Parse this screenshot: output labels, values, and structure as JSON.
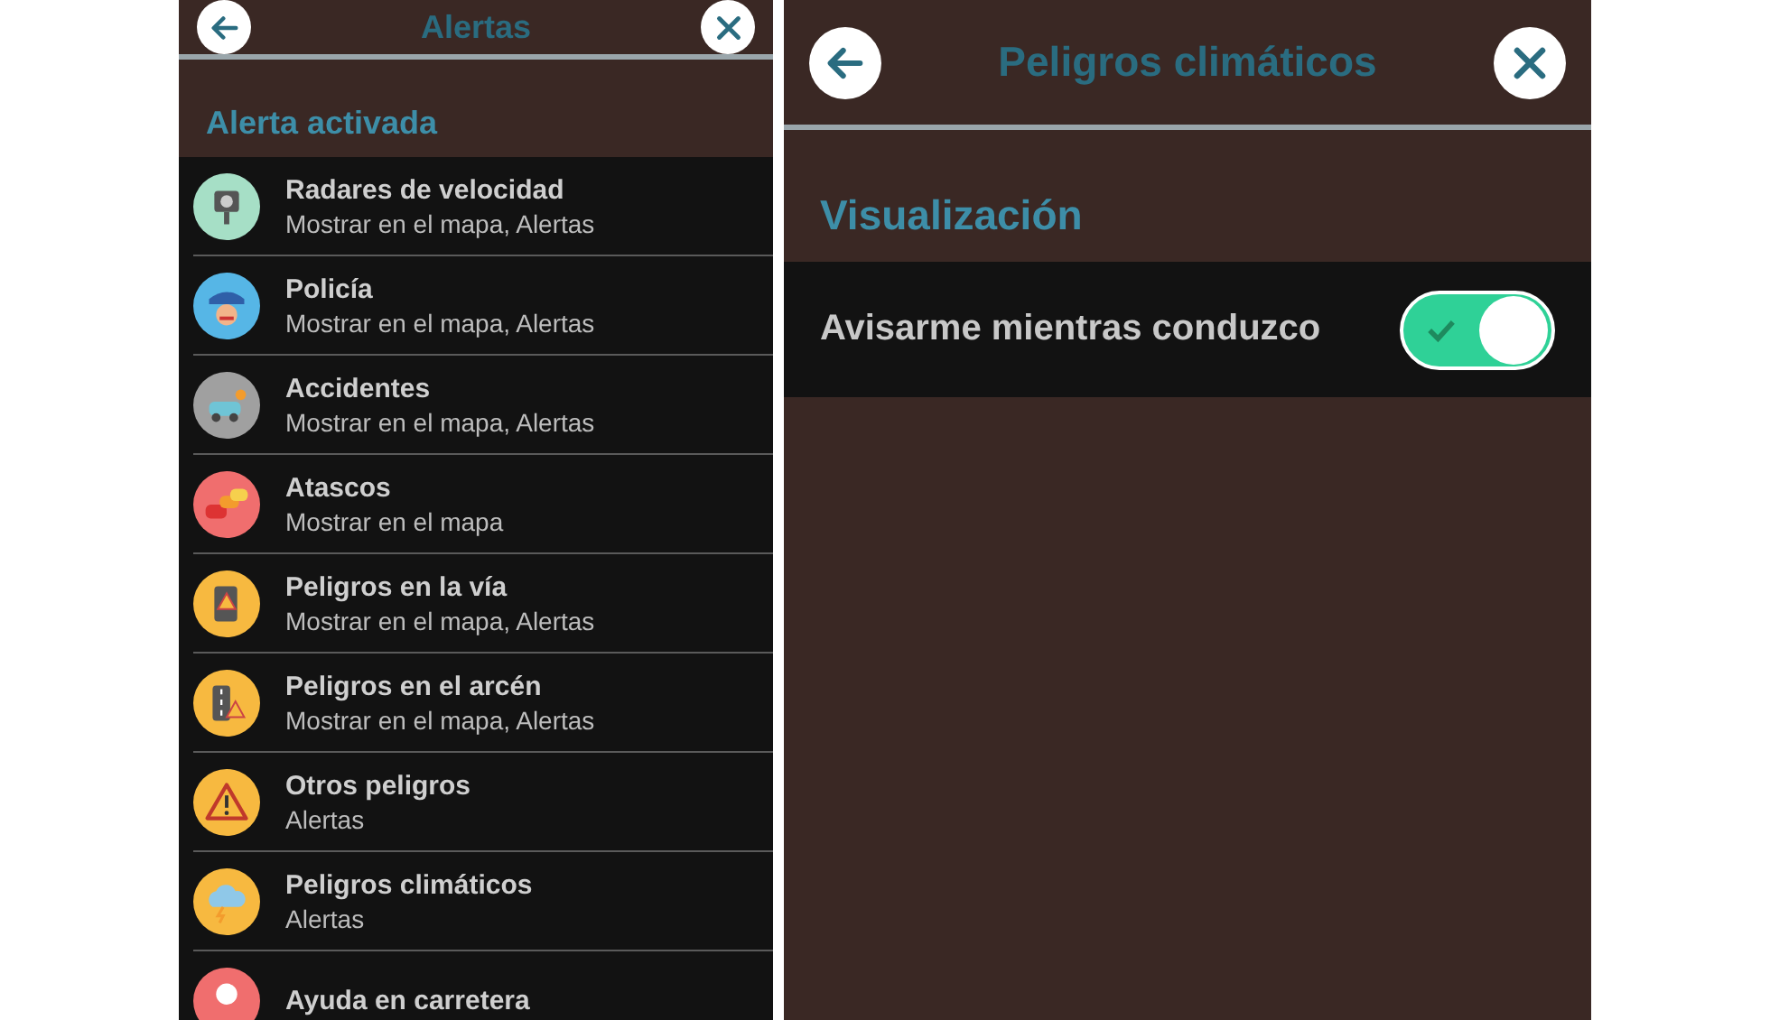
{
  "alerts_screen": {
    "title": "Alertas",
    "section": "Alerta activada",
    "items": [
      {
        "kind": "radar",
        "color": "#a6dfc6",
        "title": "Radares de velocidad",
        "subtitle": "Mostrar en el mapa, Alertas"
      },
      {
        "kind": "police",
        "color": "#56b6e6",
        "title": "Policía",
        "subtitle": "Mostrar en el mapa, Alertas"
      },
      {
        "kind": "accident",
        "color": "#a0a0a0",
        "title": "Accidentes",
        "subtitle": "Mostrar en el mapa, Alertas"
      },
      {
        "kind": "traffic",
        "color": "#f06e6e",
        "title": "Atascos",
        "subtitle": "Mostrar en el mapa"
      },
      {
        "kind": "road",
        "color": "#f7b940",
        "title": "Peligros en la vía",
        "subtitle": "Mostrar en el mapa, Alertas"
      },
      {
        "kind": "shoulder",
        "color": "#f7b940",
        "title": "Peligros en el arcén",
        "subtitle": "Mostrar en el mapa, Alertas"
      },
      {
        "kind": "warning",
        "color": "#f7b940",
        "title": "Otros peligros",
        "subtitle": "Alertas"
      },
      {
        "kind": "weather",
        "color": "#f7b940",
        "title": "Peligros climáticos",
        "subtitle": "Alertas"
      },
      {
        "kind": "help",
        "color": "#f06e6e",
        "title": "Ayuda en carretera"
      }
    ]
  },
  "detail_screen": {
    "title": "Peligros climáticos",
    "section": "Visualización",
    "settings": [
      {
        "label": "Avisarme mientras conduzco",
        "on": true
      }
    ]
  }
}
